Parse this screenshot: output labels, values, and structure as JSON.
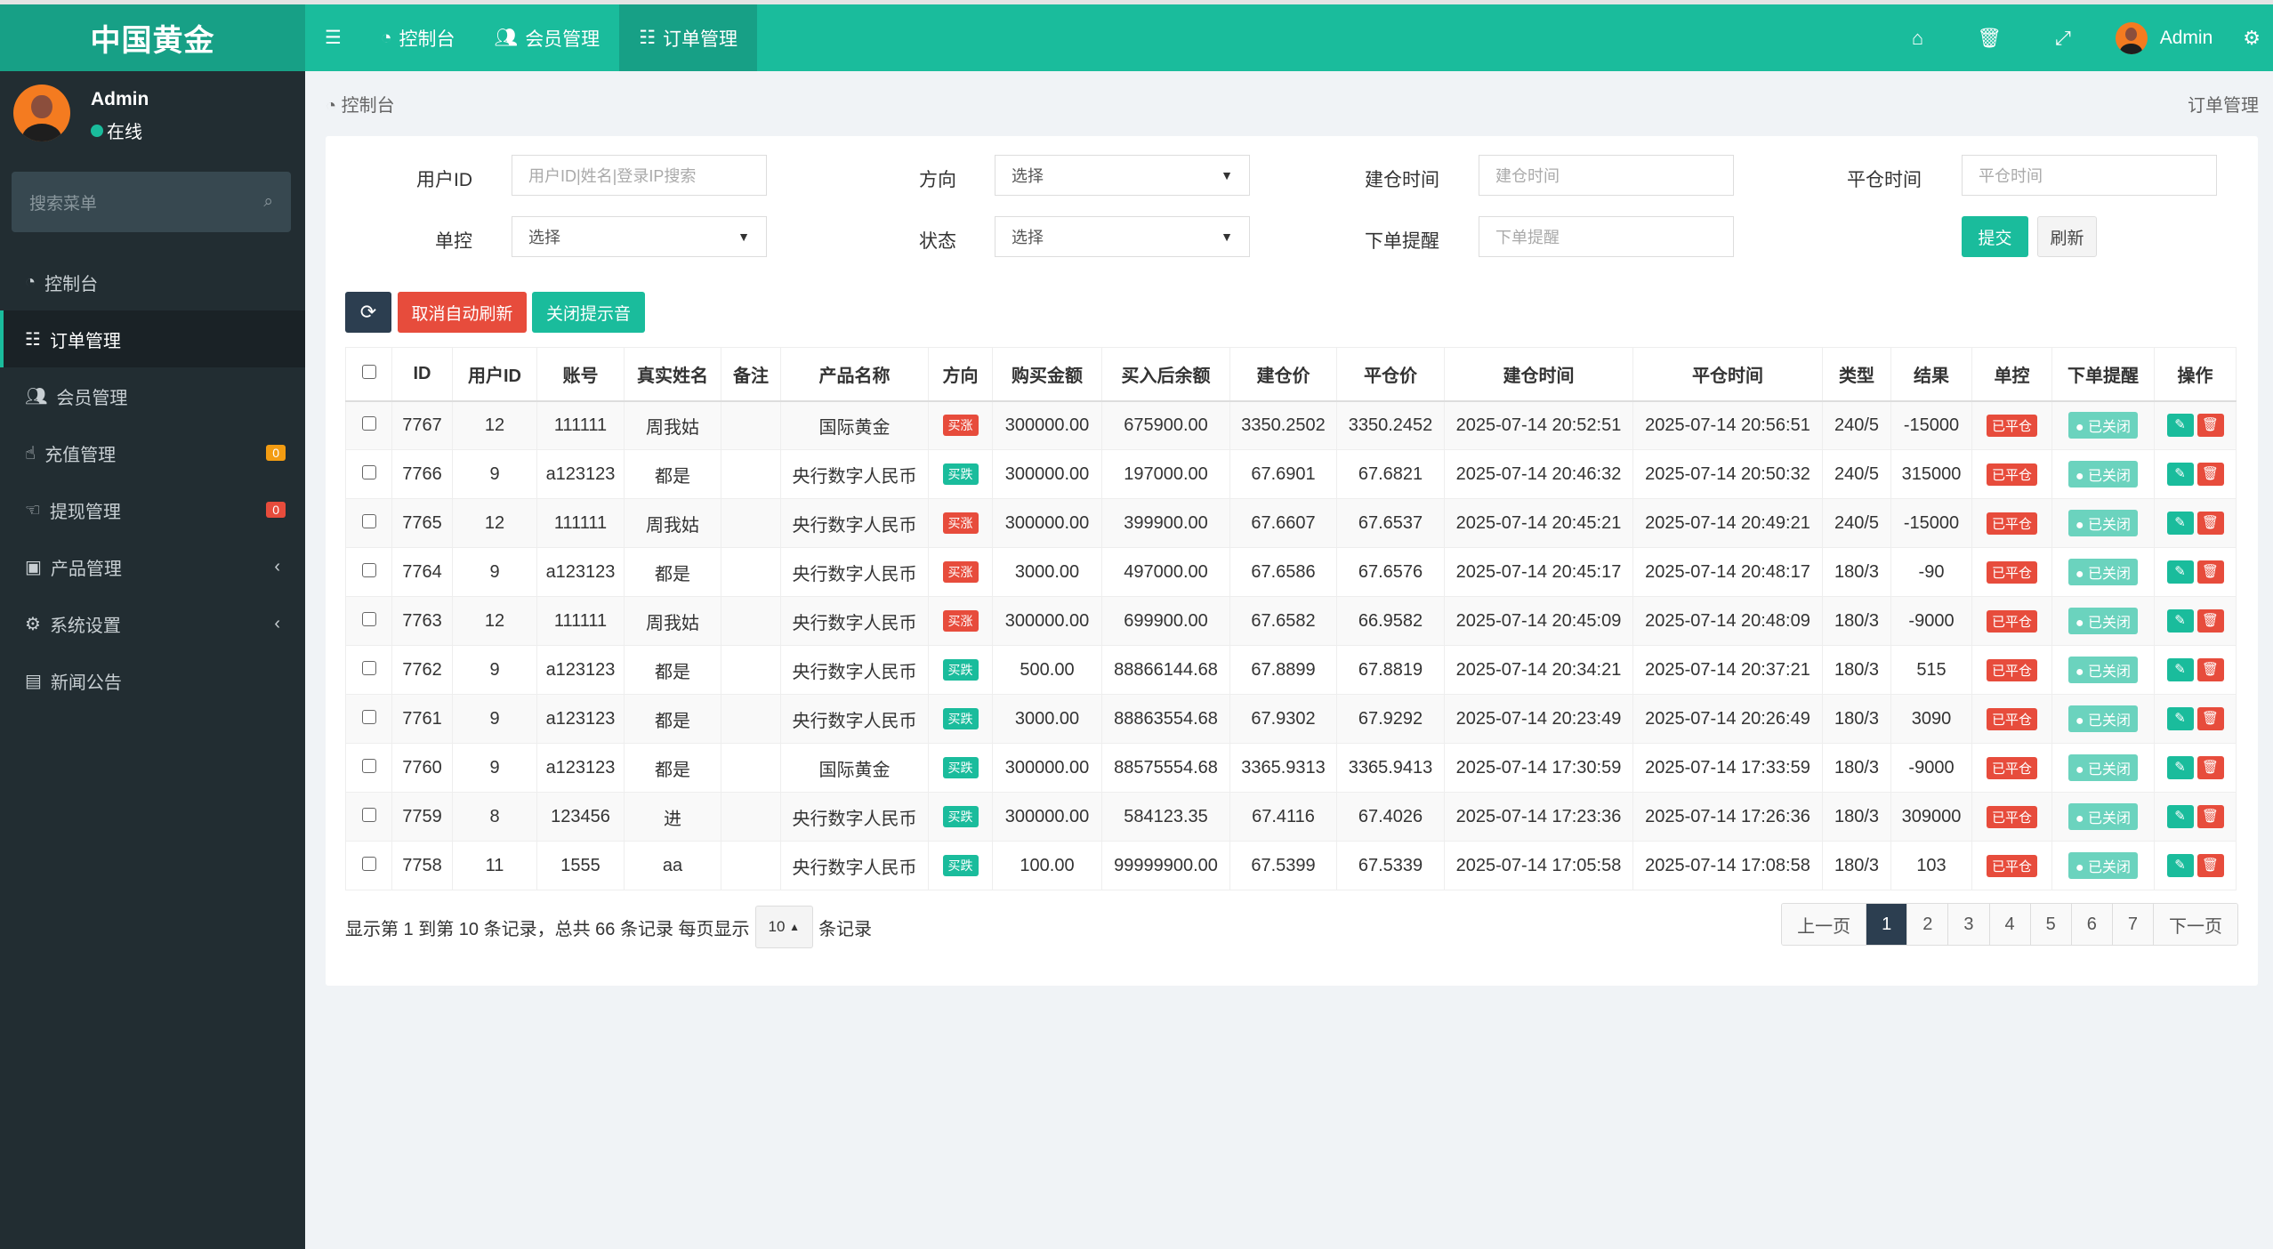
{
  "brand": "中国黄金",
  "colors": {
    "primary": "#1abc9c",
    "danger": "#e74c3c",
    "dark": "#2c3e50",
    "sidebar": "#222d32"
  },
  "topnav": {
    "items": [
      {
        "label": "控制台",
        "icon": "dashboard-icon"
      },
      {
        "label": "会员管理",
        "icon": "users-icon"
      },
      {
        "label": "订单管理",
        "icon": "list-icon",
        "active": true
      }
    ],
    "user": "Admin"
  },
  "sidebar": {
    "user": {
      "name": "Admin",
      "status": "在线"
    },
    "search_placeholder": "搜索菜单",
    "items": [
      {
        "label": "控制台"
      },
      {
        "label": "订单管理",
        "active": true
      },
      {
        "label": "会员管理"
      },
      {
        "label": "充值管理",
        "badge": "0"
      },
      {
        "label": "提现管理",
        "badge": "0"
      },
      {
        "label": "产品管理"
      },
      {
        "label": "系统设置"
      },
      {
        "label": "新闻公告"
      }
    ]
  },
  "breadcrumb": {
    "home": "控制台",
    "current": "订单管理"
  },
  "filters": {
    "user_id": {
      "label": "用户ID",
      "placeholder": "用户ID|姓名|登录IP搜索"
    },
    "direction": {
      "label": "方向",
      "value": "选择"
    },
    "open_time": {
      "label": "建仓时间",
      "placeholder": "建仓时间"
    },
    "close_time": {
      "label": "平仓时间",
      "placeholder": "平仓时间"
    },
    "control": {
      "label": "单控",
      "value": "选择"
    },
    "status": {
      "label": "状态",
      "value": "选择"
    },
    "order_alert": {
      "label": "下单提醒",
      "placeholder": "下单提醒"
    },
    "submit": "提交",
    "reset": "刷新"
  },
  "toolbar": {
    "cancel_auto_refresh": "取消自动刷新",
    "mute": "关闭提示音"
  },
  "table": {
    "headers": [
      "ID",
      "用户ID",
      "账号",
      "真实姓名",
      "备注",
      "产品名称",
      "方向",
      "购买金额",
      "买入后余额",
      "建仓价",
      "平仓价",
      "建仓时间",
      "平仓时间",
      "类型",
      "结果",
      "单控",
      "下单提醒",
      "操作"
    ],
    "rows": [
      [
        "7767",
        "12",
        "111111",
        "周我姑",
        "",
        "国际黄金",
        "买涨",
        "300000.00",
        "675900.00",
        "3350.2502",
        "3350.2452",
        "2025-07-14 20:52:51",
        "2025-07-14 20:56:51",
        "240/5",
        "-15000",
        "已平仓",
        "已关闭"
      ],
      [
        "7766",
        "9",
        "a123123",
        "都是",
        "",
        "央行数字人民币",
        "买跌",
        "300000.00",
        "197000.00",
        "67.6901",
        "67.6821",
        "2025-07-14 20:46:32",
        "2025-07-14 20:50:32",
        "240/5",
        "315000",
        "已平仓",
        "已关闭"
      ],
      [
        "7765",
        "12",
        "111111",
        "周我姑",
        "",
        "央行数字人民币",
        "买涨",
        "300000.00",
        "399900.00",
        "67.6607",
        "67.6537",
        "2025-07-14 20:45:21",
        "2025-07-14 20:49:21",
        "240/5",
        "-15000",
        "已平仓",
        "已关闭"
      ],
      [
        "7764",
        "9",
        "a123123",
        "都是",
        "",
        "央行数字人民币",
        "买涨",
        "3000.00",
        "497000.00",
        "67.6586",
        "67.6576",
        "2025-07-14 20:45:17",
        "2025-07-14 20:48:17",
        "180/3",
        "-90",
        "已平仓",
        "已关闭"
      ],
      [
        "7763",
        "12",
        "111111",
        "周我姑",
        "",
        "央行数字人民币",
        "买涨",
        "300000.00",
        "699900.00",
        "67.6582",
        "66.9582",
        "2025-07-14 20:45:09",
        "2025-07-14 20:48:09",
        "180/3",
        "-9000",
        "已平仓",
        "已关闭"
      ],
      [
        "7762",
        "9",
        "a123123",
        "都是",
        "",
        "央行数字人民币",
        "买跌",
        "500.00",
        "88866144.68",
        "67.8899",
        "67.8819",
        "2025-07-14 20:34:21",
        "2025-07-14 20:37:21",
        "180/3",
        "515",
        "已平仓",
        "已关闭"
      ],
      [
        "7761",
        "9",
        "a123123",
        "都是",
        "",
        "央行数字人民币",
        "买跌",
        "3000.00",
        "88863554.68",
        "67.9302",
        "67.9292",
        "2025-07-14 20:23:49",
        "2025-07-14 20:26:49",
        "180/3",
        "3090",
        "已平仓",
        "已关闭"
      ],
      [
        "7760",
        "9",
        "a123123",
        "都是",
        "",
        "国际黄金",
        "买跌",
        "300000.00",
        "88575554.68",
        "3365.9313",
        "3365.9413",
        "2025-07-14 17:30:59",
        "2025-07-14 17:33:59",
        "180/3",
        "-9000",
        "已平仓",
        "已关闭"
      ],
      [
        "7759",
        "8",
        "123456",
        "进",
        "",
        "央行数字人民币",
        "买跌",
        "300000.00",
        "584123.35",
        "67.4116",
        "67.4026",
        "2025-07-14 17:23:36",
        "2025-07-14 17:26:36",
        "180/3",
        "309000",
        "已平仓",
        "已关闭"
      ],
      [
        "7758",
        "11",
        "1555",
        "aa",
        "",
        "央行数字人民币",
        "买跌",
        "100.00",
        "99999900.00",
        "67.5399",
        "67.5339",
        "2025-07-14 17:05:58",
        "2025-07-14 17:08:58",
        "180/3",
        "103",
        "已平仓",
        "已关闭"
      ]
    ]
  },
  "pagination": {
    "info": "显示第 1 到第 10 条记录，总共 66 条记录 每页显示",
    "page_size": "10",
    "suffix": "条记录",
    "prev": "上一页",
    "next": "下一页",
    "pages": [
      "1",
      "2",
      "3",
      "4",
      "5",
      "6",
      "7"
    ],
    "current": "1"
  }
}
